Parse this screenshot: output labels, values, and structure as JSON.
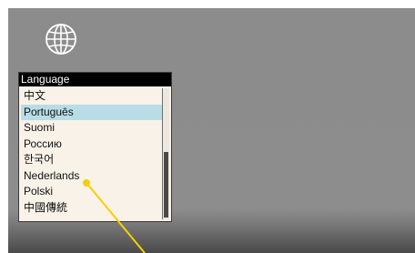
{
  "panel": {
    "title": "Language",
    "items": [
      {
        "label": "中文",
        "selected": false
      },
      {
        "label": "Português",
        "selected": true
      },
      {
        "label": "Suomi",
        "selected": false
      },
      {
        "label": "Россию",
        "selected": false
      },
      {
        "label": "한국어",
        "selected": false
      },
      {
        "label": "Nederlands",
        "selected": false
      },
      {
        "label": "Polski",
        "selected": false
      },
      {
        "label": "中國傳統",
        "selected": false
      }
    ]
  },
  "icons": {
    "top_left": "globe-icon",
    "pointer": "laser-pointer-line"
  },
  "colors": {
    "background": "#8c8c8c",
    "panel_bg": "#f8f2e8",
    "title_bar": "#000000",
    "selection": "#b8dde6",
    "pointer": "#f5d000"
  }
}
